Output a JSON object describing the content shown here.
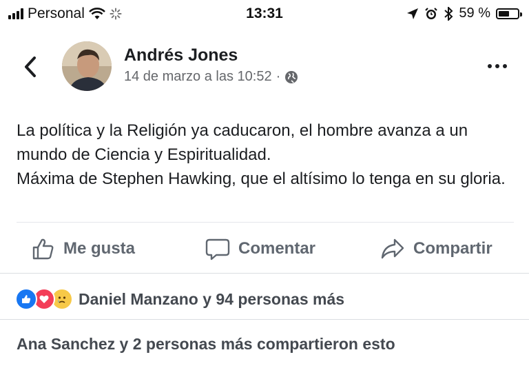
{
  "status_bar": {
    "carrier": "Personal",
    "time": "13:31",
    "battery_text": "59 %",
    "battery_level": 0.59
  },
  "post": {
    "author": "Andrés Jones",
    "timestamp": "14 de marzo a las 10:52",
    "separator": "·",
    "privacy_icon": "globe-icon",
    "text_lines": [
      "La política y la Religión ya caducaron, el hombre avanza a un mundo de Ciencia y Espiritualidad.",
      "Máxima de Stephen Hawking, que el altísimo lo tenga en su gloria."
    ]
  },
  "actions": {
    "like_label": "Me gusta",
    "comment_label": "Comentar",
    "share_label": "Compartir"
  },
  "reactions": {
    "icons": [
      "like-icon",
      "love-icon",
      "sad-icon"
    ],
    "summary": "Daniel Manzano y 94 personas más"
  },
  "shares": {
    "summary": "Ana Sanchez y 2 personas más compartieron esto"
  },
  "colors": {
    "accent": "#1877f2",
    "love": "#f33e58",
    "sad": "#f7c948",
    "secondary_text": "#65676b"
  }
}
